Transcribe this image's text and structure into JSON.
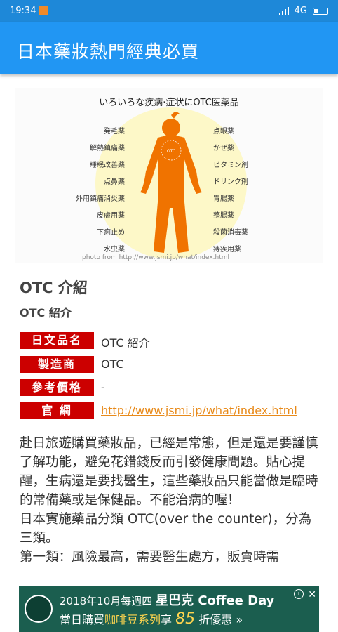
{
  "status_bar": {
    "time": "19:34",
    "network": "4G"
  },
  "app_bar": {
    "title": "日本藥妝熱門經典必買"
  },
  "hero_image": {
    "heading": "いろいろな疾病·症状にOTC医薬品",
    "left_labels": [
      "発毛薬",
      "解熱鎮痛薬",
      "睡眠改善薬",
      "点鼻薬",
      "外用鎮痛消炎薬",
      "皮膚用薬",
      "下痢止め",
      "水虫薬"
    ],
    "right_labels": [
      "点眼薬",
      "かぜ薬",
      "ビタミン剤",
      "ドリンク剤",
      "胃腸薬",
      "整腸薬",
      "殺菌消毒薬",
      "痔疾用薬"
    ],
    "center_label": "OTC",
    "credit": "photo from http://www.jsmi.jp/what/index.html"
  },
  "article": {
    "title": "OTC 介紹",
    "subtitle": "OTC 紹介",
    "rows": [
      {
        "label": "日文品名",
        "value": "OTC 紹介"
      },
      {
        "label": "製造商",
        "value": "OTC"
      },
      {
        "label": "參考價格",
        "value": "-"
      },
      {
        "label": "官 網",
        "value": "http://www.jsmi.jp/what/index.html"
      }
    ],
    "paragraphs": [
      "赴日旅遊購買藥妝品，已經是常態，但是還是要謹慎了解功能，避免花錯錢反而引發健康問題。貼心提醒，生病還是要找醫生，這些藥妝品只能當做是臨時的常備藥或是保健品。不能治病的喔！",
      "日本實施藥品分類 OTC(over the counter)，分為三類。",
      "第一類：風險最高，需要醫生處方，販賣時需"
    ]
  },
  "ad": {
    "line1_prefix": "2018年10月每週四",
    "line1_brand": "星巴克 Coffee Day",
    "line2_prefix": "當日購買",
    "line2_highlight": "咖啡豆系列",
    "line2_mid": "享",
    "line2_number": "85",
    "line2_suffix": "折優惠 »",
    "close": "✕",
    "info": "i"
  }
}
